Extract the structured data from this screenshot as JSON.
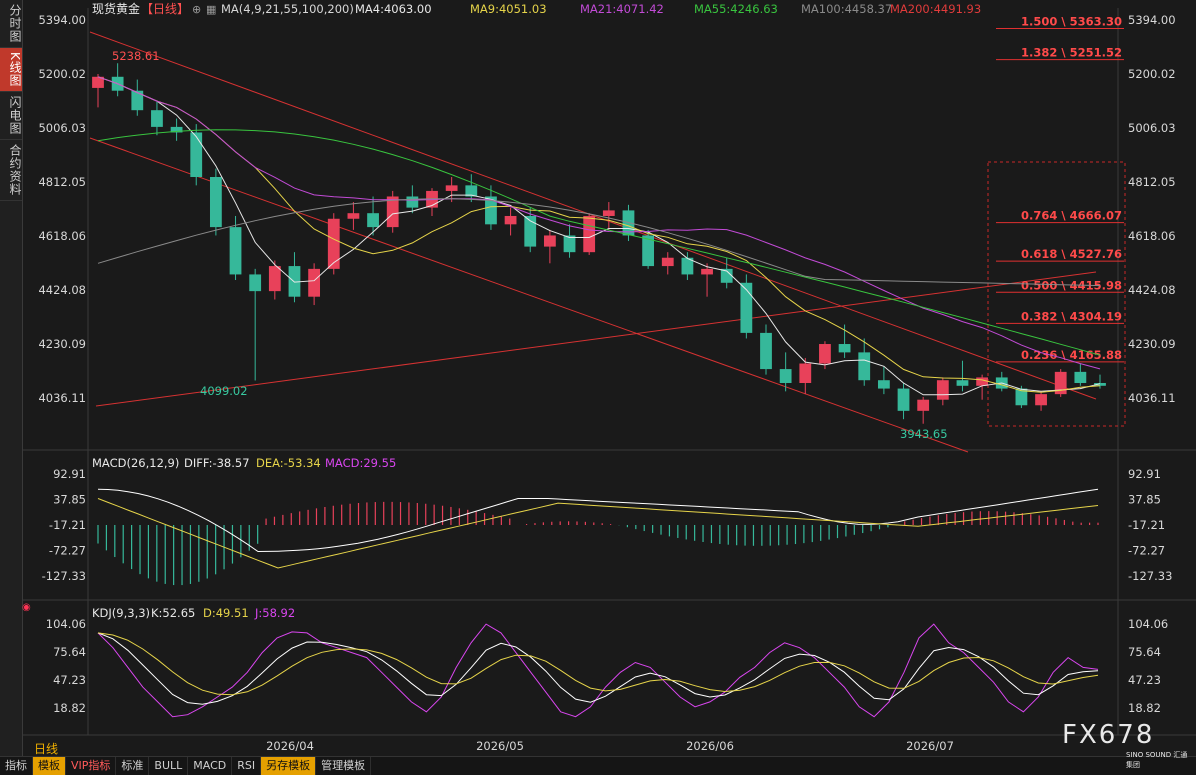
{
  "sidebar": {
    "tabs": [
      {
        "label": "分时图",
        "active": false
      },
      {
        "label": "K线图",
        "active": true
      },
      {
        "label": "闪电图",
        "active": false
      },
      {
        "label": "合约资料",
        "active": false
      }
    ]
  },
  "header": {
    "symbol": "现货黄金",
    "period": "【日线】",
    "ma_params": "MA(4,9,21,55,100,200)",
    "ma_values": [
      {
        "label": "MA4:4063.00",
        "color": "#e8e8e8"
      },
      {
        "label": "MA9:4051.03",
        "color": "#e6d44a"
      },
      {
        "label": "MA21:4071.42",
        "color": "#c24bd6"
      },
      {
        "label": "MA55:4246.63",
        "color": "#39c43f"
      },
      {
        "label": "MA100:4458.37",
        "color": "#8a8a8a"
      },
      {
        "label": "MA200:4491.93",
        "color": "#e03b3b"
      }
    ]
  },
  "price_axis": {
    "ticks": [
      "5394.00",
      "5200.02",
      "5006.03",
      "4812.05",
      "4618.06",
      "4424.08",
      "4230.09",
      "4036.11"
    ]
  },
  "annotations": {
    "high_label": "5238.61",
    "low_label_1": "4099.02",
    "low_label_2": "3943.65"
  },
  "fib_levels": [
    {
      "label": "1.500 \\ 5363.30",
      "price": 5363.3
    },
    {
      "label": "1.382 \\ 5251.52",
      "price": 5251.52
    },
    {
      "label": "0.764 \\ 4666.07",
      "price": 4666.07
    },
    {
      "label": "0.618 \\ 4527.76",
      "price": 4527.76
    },
    {
      "label": "0.500 \\ 4415.98",
      "price": 4415.98
    },
    {
      "label": "0.382 \\ 4304.19",
      "price": 4304.19
    },
    {
      "label": "0.236 \\ 4165.88",
      "price": 4165.88
    }
  ],
  "macd_panel": {
    "title": "MACD(26,12,9)",
    "diff": "DIFF:-38.57",
    "dea": "DEA:-53.34",
    "macd": "MACD:29.55",
    "ticks": [
      "92.91",
      "37.85",
      "-17.21",
      "-72.27",
      "-127.33"
    ]
  },
  "kdj_panel": {
    "title": "KDJ(9,3,3)",
    "k": "K:52.65",
    "d": "D:49.51",
    "j": "J:58.92",
    "ticks": [
      "104.06",
      "75.64",
      "47.23",
      "18.82"
    ]
  },
  "date_axis": {
    "labels": [
      "2026/04",
      "2026/05",
      "2026/06",
      "2026/07"
    ]
  },
  "period_tag": "日线",
  "bottom_bar": {
    "items": [
      "指标",
      "模板",
      "VIP指标",
      "标准",
      "BULL",
      "MACD",
      "RSI",
      "另存模板",
      "管理模板"
    ]
  },
  "logo": {
    "text": "FX678",
    "sub": "SINO SOUND 汇通集团"
  },
  "colors": {
    "up": "#e8415a",
    "down": "#36b89a",
    "background": "#1a1a1a"
  },
  "chart_data": {
    "type": "candlestick",
    "period": "daily",
    "ylim": [
      3943.65,
      5394.0
    ],
    "ohlc": [
      [
        5150,
        5200,
        5080,
        5190
      ],
      [
        5190,
        5238.61,
        5120,
        5140
      ],
      [
        5140,
        5180,
        5050,
        5070
      ],
      [
        5070,
        5100,
        4980,
        5010
      ],
      [
        5010,
        5040,
        4960,
        4990
      ],
      [
        4990,
        5020,
        4800,
        4830
      ],
      [
        4830,
        4860,
        4620,
        4650
      ],
      [
        4650,
        4690,
        4460,
        4480
      ],
      [
        4480,
        4500,
        4099.02,
        4420
      ],
      [
        4420,
        4530,
        4390,
        4510
      ],
      [
        4510,
        4560,
        4380,
        4400
      ],
      [
        4400,
        4520,
        4370,
        4500
      ],
      [
        4500,
        4700,
        4480,
        4680
      ],
      [
        4680,
        4740,
        4640,
        4700
      ],
      [
        4700,
        4760,
        4620,
        4650
      ],
      [
        4650,
        4780,
        4630,
        4760
      ],
      [
        4760,
        4800,
        4700,
        4720
      ],
      [
        4720,
        4790,
        4690,
        4780
      ],
      [
        4780,
        4830,
        4740,
        4800
      ],
      [
        4800,
        4840,
        4740,
        4760
      ],
      [
        4760,
        4800,
        4640,
        4660
      ],
      [
        4660,
        4720,
        4620,
        4690
      ],
      [
        4690,
        4720,
        4560,
        4580
      ],
      [
        4580,
        4640,
        4520,
        4620
      ],
      [
        4620,
        4660,
        4540,
        4560
      ],
      [
        4560,
        4700,
        4550,
        4690
      ],
      [
        4690,
        4740,
        4640,
        4710
      ],
      [
        4710,
        4730,
        4600,
        4620
      ],
      [
        4620,
        4640,
        4500,
        4510
      ],
      [
        4510,
        4560,
        4480,
        4540
      ],
      [
        4540,
        4560,
        4460,
        4480
      ],
      [
        4480,
        4520,
        4400,
        4500
      ],
      [
        4500,
        4540,
        4430,
        4450
      ],
      [
        4450,
        4480,
        4250,
        4270
      ],
      [
        4270,
        4300,
        4120,
        4140
      ],
      [
        4140,
        4200,
        4060,
        4090
      ],
      [
        4090,
        4180,
        4050,
        4160
      ],
      [
        4160,
        4240,
        4140,
        4230
      ],
      [
        4230,
        4300,
        4180,
        4200
      ],
      [
        4200,
        4250,
        4080,
        4100
      ],
      [
        4100,
        4150,
        4050,
        4070
      ],
      [
        4070,
        4090,
        3960,
        3990
      ],
      [
        3990,
        4040,
        3943.65,
        4030
      ],
      [
        4030,
        4110,
        4010,
        4100
      ],
      [
        4100,
        4170,
        4060,
        4080
      ],
      [
        4080,
        4120,
        4030,
        4110
      ],
      [
        4110,
        4130,
        4060,
        4070
      ],
      [
        4070,
        4080,
        4000,
        4010
      ],
      [
        4010,
        4060,
        3990,
        4050
      ],
      [
        4050,
        4140,
        4040,
        4130
      ],
      [
        4130,
        4160,
        4080,
        4090
      ],
      [
        4090,
        4120,
        4070,
        4080
      ]
    ]
  }
}
